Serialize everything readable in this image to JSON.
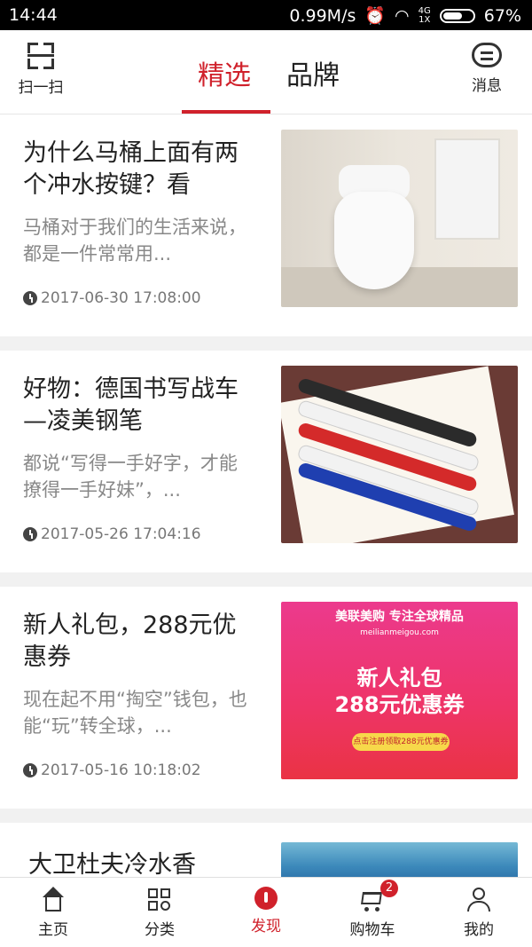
{
  "status_bar": {
    "time": "14:44",
    "speed": "0.99M/s",
    "network_top": "4G",
    "network_bottom": "1X",
    "battery": "67%",
    "battery_level": 0.67
  },
  "header": {
    "scan_label": "扫一扫",
    "tabs": [
      {
        "label": "精选"
      },
      {
        "label": "品牌"
      }
    ],
    "message_label": "消息",
    "accent": "#d0212b"
  },
  "articles": [
    {
      "title": "为什么马桶上面有两个冲水按键？看",
      "summary": "马桶对于我们的生活来说，都是一件常常用...",
      "date": "2017-06-30 17:08:00"
    },
    {
      "title": "好物：德国书写战车—凌美钢笔",
      "summary": "都说“写得一手好字，才能撩得一手好妹”，...",
      "date": "2017-05-26 17:04:16"
    },
    {
      "title": "新人礼包，288元优惠券",
      "summary": "现在起不用“掏空”钱包，也能“玩”转全球，...",
      "date": "2017-05-16 10:18:02",
      "promo": {
        "brand": "美联美购 专注全球精品",
        "url": "meilianmeigou.com",
        "line1": "新人礼包",
        "line2": "288元优惠券",
        "cta": "点击注册领取288元优惠券"
      }
    },
    {
      "title": "大卫杜夫冷水香"
    }
  ],
  "bottom_nav": [
    {
      "label": "主页",
      "icon": "home-icon"
    },
    {
      "label": "分类",
      "icon": "category-icon"
    },
    {
      "label": "发现",
      "icon": "discover-icon"
    },
    {
      "label": "购物车",
      "icon": "cart-icon",
      "badge": "2"
    },
    {
      "label": "我的",
      "icon": "profile-icon"
    }
  ]
}
